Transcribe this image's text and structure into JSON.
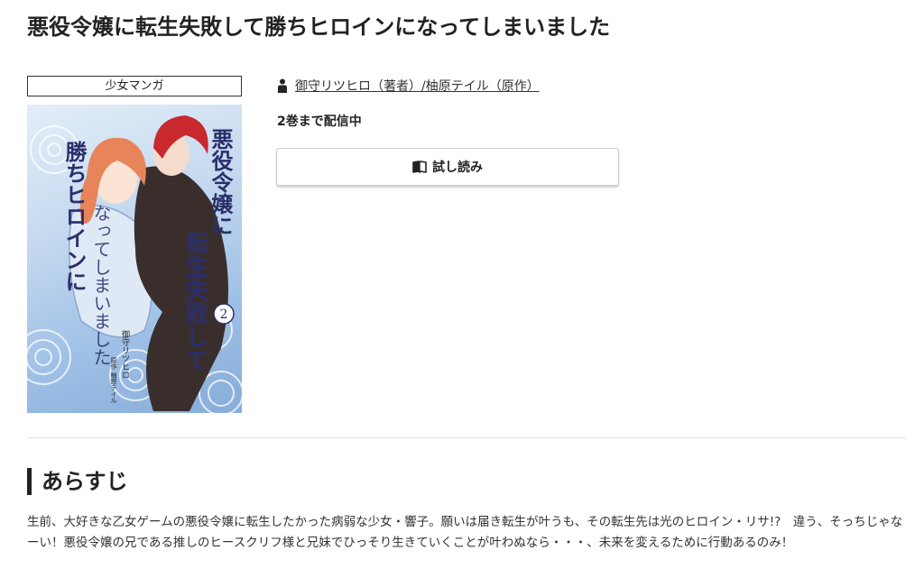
{
  "title": "悪役令嬢に転生失敗して勝ちヒロインになってしまいました",
  "genre": "少女マンガ",
  "cover": {
    "title_lines": [
      "悪役令嬢に",
      "転生失敗して",
      "勝ちヒロインに",
      "なってしまいました"
    ],
    "volume": "2",
    "author": "御守リツヒロ",
    "original": "原作 柚原テイル",
    "colors": {
      "background": "#c6daf0",
      "title_text": "#2a2f6b",
      "heroine_hair": "#e8845a",
      "hero_hair": "#c8282e",
      "suit": "#3a2e2c"
    }
  },
  "author": {
    "icon": "person-icon",
    "text": "御守リツヒロ（著者）/柚原テイル（原作）"
  },
  "availability": "2巻まで配信中",
  "trial": {
    "icon": "book-icon",
    "label": "試し読み"
  },
  "synopsis": {
    "heading": "あらすじ",
    "text": "生前、大好きな乙女ゲームの悪役令嬢に転生したかった病弱な少女・響子。願いは届き転生が叶うも、その転生先は光のヒロイン・リサ!?　違う、そっちじゃなーい！悪役令嬢の兄である推しのヒースクリフ様と兄妹でひっそり生きていくことが叶わぬなら・・・、未来を変えるために行動あるのみ！"
  }
}
